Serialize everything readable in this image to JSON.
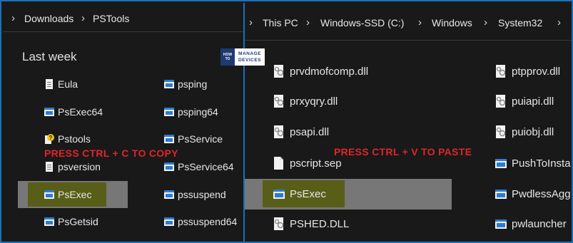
{
  "left_pane": {
    "breadcrumb": [
      "Downloads",
      "PSTools"
    ],
    "group_title": "Last week",
    "col1": [
      {
        "label": "Eula",
        "icon": "text-file-icon"
      },
      {
        "label": "PsExec64",
        "icon": "exe-app-icon"
      },
      {
        "label": "Pstools",
        "icon": "help-file-icon"
      },
      {
        "label": "psversion",
        "icon": "text-file-icon"
      },
      {
        "label": "PsExec",
        "icon": "exe-app-icon"
      },
      {
        "label": "PsGetsid",
        "icon": "exe-app-icon"
      }
    ],
    "col2": [
      {
        "label": "psping",
        "icon": "exe-app-icon"
      },
      {
        "label": "psping64",
        "icon": "exe-app-icon"
      },
      {
        "label": "PsService",
        "icon": "exe-app-icon"
      },
      {
        "label": "PsService64",
        "icon": "exe-app-icon"
      },
      {
        "label": "pssuspend",
        "icon": "exe-app-icon"
      },
      {
        "label": "pssuspend64",
        "icon": "exe-app-icon"
      }
    ],
    "annotation": "PRESS CTRL + C TO COPY"
  },
  "right_pane": {
    "breadcrumb": [
      "This PC",
      "Windows-SSD (C:)",
      "Windows",
      "System32"
    ],
    "col1": [
      {
        "label": "prvdmofcomp.dll",
        "icon": "dll-file-icon"
      },
      {
        "label": "prxyqry.dll",
        "icon": "dll-file-icon"
      },
      {
        "label": "psapi.dll",
        "icon": "dll-file-icon"
      },
      {
        "label": "pscript.sep",
        "icon": "blank-file-icon"
      },
      {
        "label": "PsExec",
        "icon": "exe-app-icon"
      },
      {
        "label": "PSHED.DLL",
        "icon": "dll-file-icon"
      }
    ],
    "col2": [
      {
        "label": "ptpprov.dll",
        "icon": "dll-file-icon"
      },
      {
        "label": "puiapi.dll",
        "icon": "dll-file-icon"
      },
      {
        "label": "puiobj.dll",
        "icon": "dll-file-icon"
      },
      {
        "label": "PushToInsta",
        "icon": "exe-app-icon"
      },
      {
        "label": "PwdlessAgg",
        "icon": "exe-app-icon"
      },
      {
        "label": "pwlauncher",
        "icon": "exe-app-icon"
      }
    ],
    "annotation": "PRESS CTRL + V TO PASTE"
  },
  "watermark": {
    "line1": "HOW",
    "line2": "TO",
    "word1": "MANAGE",
    "word2": "DEVICES"
  },
  "colors": {
    "accent": "#1d6fb8",
    "annotation": "#e0242b",
    "highlight": "#585e17"
  }
}
